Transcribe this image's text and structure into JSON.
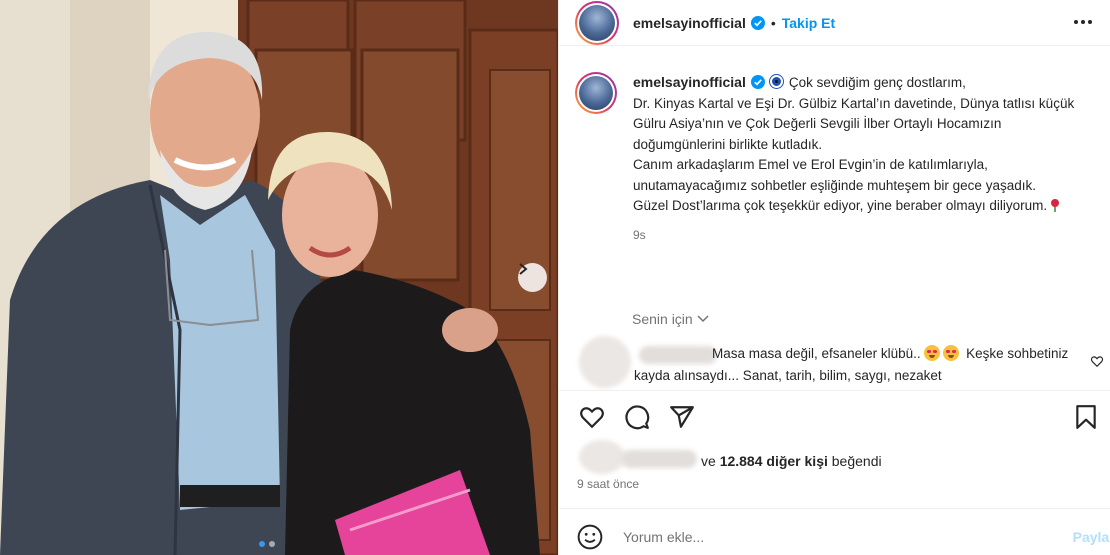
{
  "post": {
    "username": "emelsayinofficial",
    "follow_label": "Takip Et",
    "separator": "•"
  },
  "caption": {
    "username": "emelsayinofficial",
    "paragraphs": [
      "Çok sevdiğim genç dostlarım,",
      "Dr. Kinyas Kartal ve Eşi Dr. Gülbiz Kartal’ın davetinde, Dünya tatlısı küçük Gülru Asiya’nın ve Çok Değerli Sevgili İlber Ortaylı Hocamızın doğumgünlerini birlikte kutladık.",
      "Canım arkadaşlarım Emel ve Erol Evgin’in de katılımlarıyla, unutamayacağımız sohbetler eşliğinde muhteşem bir gece yaşadık.",
      "Güzel Dost’larıma çok teşekkür ediyor, yine beraber olmayı diliyorum."
    ],
    "time": "9s"
  },
  "for_you_label": "Senin için",
  "comment": {
    "text_part1": "Masa masa değil, efsaneler klübü..",
    "text_part2": "Keşke sohbetiniz kayda alınsaydı... Sanat, tarih, bilim, saygı, nezaket"
  },
  "likes": {
    "prefix": "ve",
    "count": "12.884 diğer kişi",
    "suffix": "beğendi"
  },
  "posted_ago": "9 saat önce",
  "add_comment": {
    "placeholder": "Yorum ekle...",
    "share_label": "Paylaş"
  },
  "carousel": {
    "total": 2,
    "current": 1
  },
  "colors": {
    "accent": "#0095f6",
    "text": "#262626",
    "muted": "#737373"
  },
  "icons": [
    "verified-badge-icon",
    "more-options-icon",
    "evil-eye-icon",
    "rose-icon",
    "chevron-down-icon",
    "heart-icon",
    "comment-icon",
    "share-icon",
    "bookmark-icon",
    "emoji-icon",
    "chevron-right-icon"
  ]
}
